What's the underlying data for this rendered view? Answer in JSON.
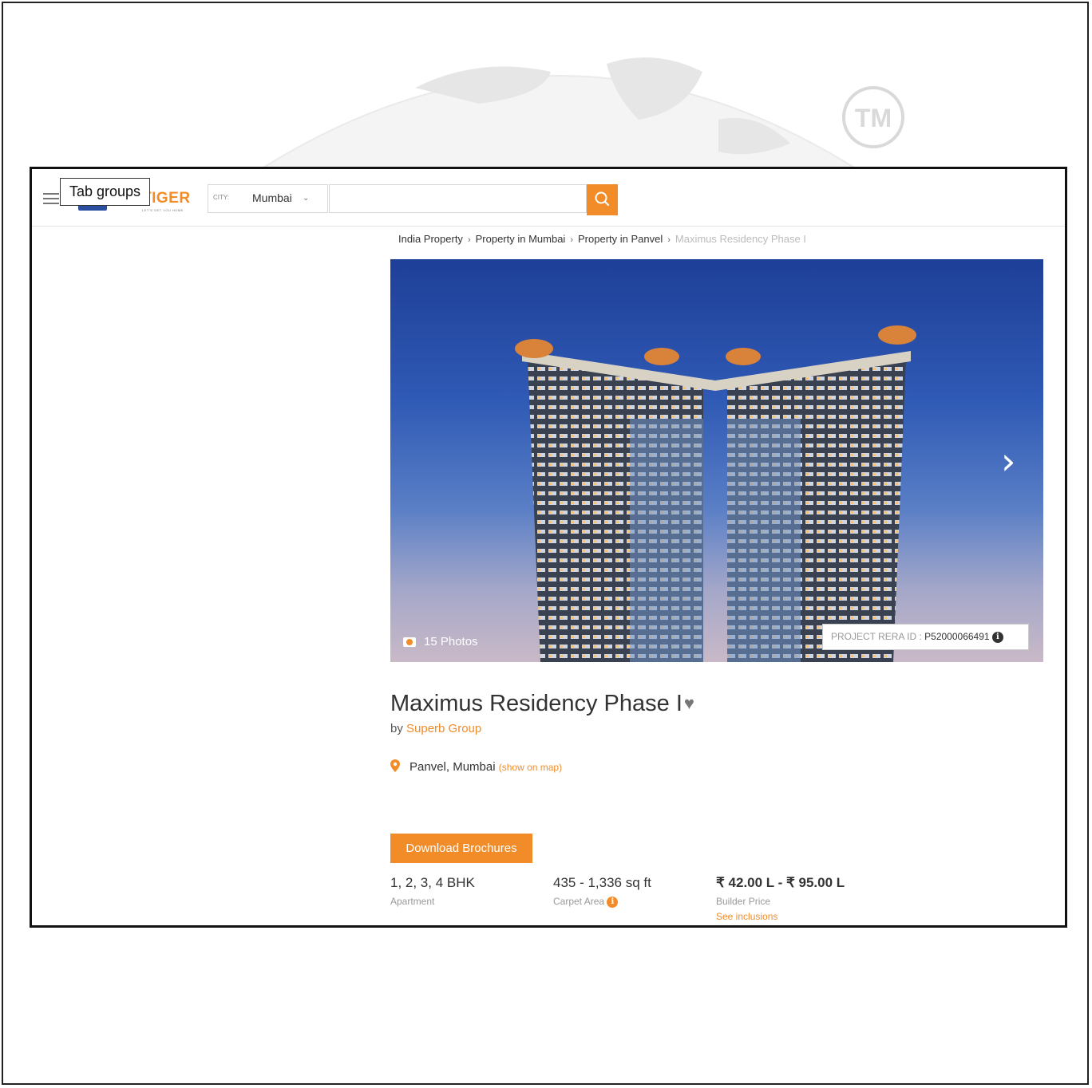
{
  "header": {
    "logo_text": "TIGER",
    "logo_tagline": "LET'S GET YOU HOME",
    "city_label": "CITY:",
    "city_value": "Mumbai",
    "search_placeholder": "",
    "tooltip": "Tab groups"
  },
  "breadcrumb": {
    "items": [
      "India Property",
      "Property in Mumbai",
      "Property in Panvel"
    ],
    "current": "Maximus Residency Phase I"
  },
  "hero": {
    "photos_count": "15 Photos",
    "rera_label": "PROJECT RERA ID : ",
    "rera_id": "P52000066491"
  },
  "project": {
    "title": "Maximus Residency Phase I",
    "by_prefix": "by",
    "builder": "Superb Group",
    "location": "Panvel, Mumbai",
    "map_link": "(show on map)",
    "download_label": "Download Brochures"
  },
  "stats": [
    {
      "value": "1, 2, 3, 4 BHK",
      "label": "Apartment"
    },
    {
      "value": "435 - 1,336 sq ft",
      "label": "Carpet Area"
    },
    {
      "value": "₹ 42.00 L - ₹ 95.00 L",
      "label": "Builder Price",
      "link": "See inclusions"
    }
  ],
  "watermark": {
    "trademark": "TM"
  },
  "colors": {
    "accent": "#f28c28",
    "brand_blue": "#2b4fa0",
    "text": "#333333"
  }
}
